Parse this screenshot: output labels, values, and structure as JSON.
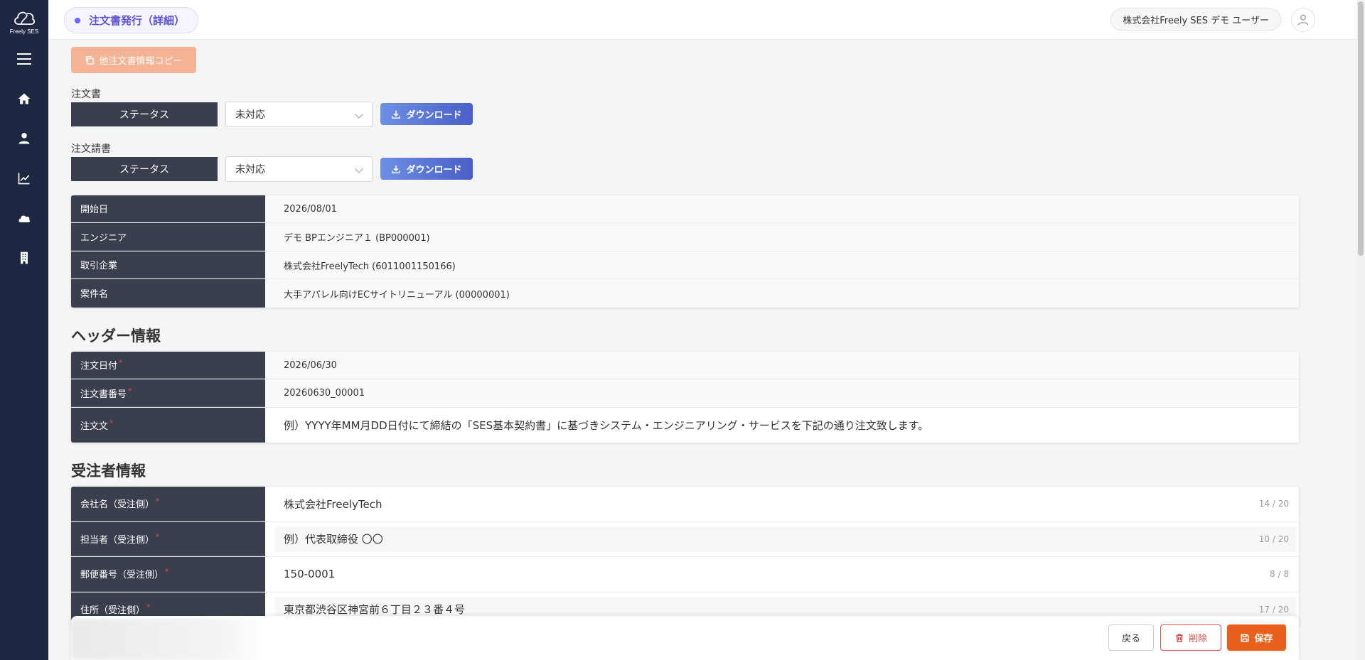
{
  "app": {
    "logo_text": "Freely SES"
  },
  "header": {
    "page_title": "注文書発行（詳細）",
    "user_label": "株式会社Freely SES デモ ユーザー"
  },
  "toolbar": {
    "copy_label": "他注文書情報コピー"
  },
  "order_doc": {
    "label": "注文書",
    "status_label": "ステータス",
    "status_value": "未対応",
    "download_label": "ダウンロード"
  },
  "order_ack": {
    "label": "注文請書",
    "status_label": "ステータス",
    "status_value": "未対応",
    "download_label": "ダウンロード"
  },
  "summary": [
    {
      "key": "開始日",
      "value": "2026/08/01"
    },
    {
      "key": "エンジニア",
      "value": "デモ BPエンジニア１ (BP000001)"
    },
    {
      "key": "取引企業",
      "value": "株式会社FreelyTech (6011001150166)"
    },
    {
      "key": "案件名",
      "value": "大手アパレル向けECサイトリニューアル (00000001)"
    }
  ],
  "header_info": {
    "title": "ヘッダー情報",
    "rows": [
      {
        "key": "注文日付",
        "value": "2026/06/30"
      },
      {
        "key": "注文書番号",
        "value": "20260630_00001"
      },
      {
        "key": "注文文",
        "value": "例）YYYY年MM月DD日付にて締結の「SES基本契約書」に基づきシステム・エンジニアリング・サービスを下記の通り注文致します。"
      }
    ]
  },
  "receiver_info": {
    "title": "受注者情報",
    "rows": [
      {
        "key": "会社名（受注側）",
        "value": "株式会社FreelyTech",
        "count": "14 / 20"
      },
      {
        "key": "担当者（受注側）",
        "value": "例）代表取締役 〇〇",
        "count": "10 / 20"
      },
      {
        "key": "郵便番号（受注側）",
        "value": "150-0001",
        "count": "8 / 8"
      },
      {
        "key": "住所（受注側）",
        "value": "東京都渋谷区神宮前６丁目２３番４号",
        "count": "17 / 20"
      }
    ]
  },
  "required_mark": "*",
  "footer": {
    "back_label": "戻る",
    "delete_label": "削除",
    "save_label": "保存"
  }
}
